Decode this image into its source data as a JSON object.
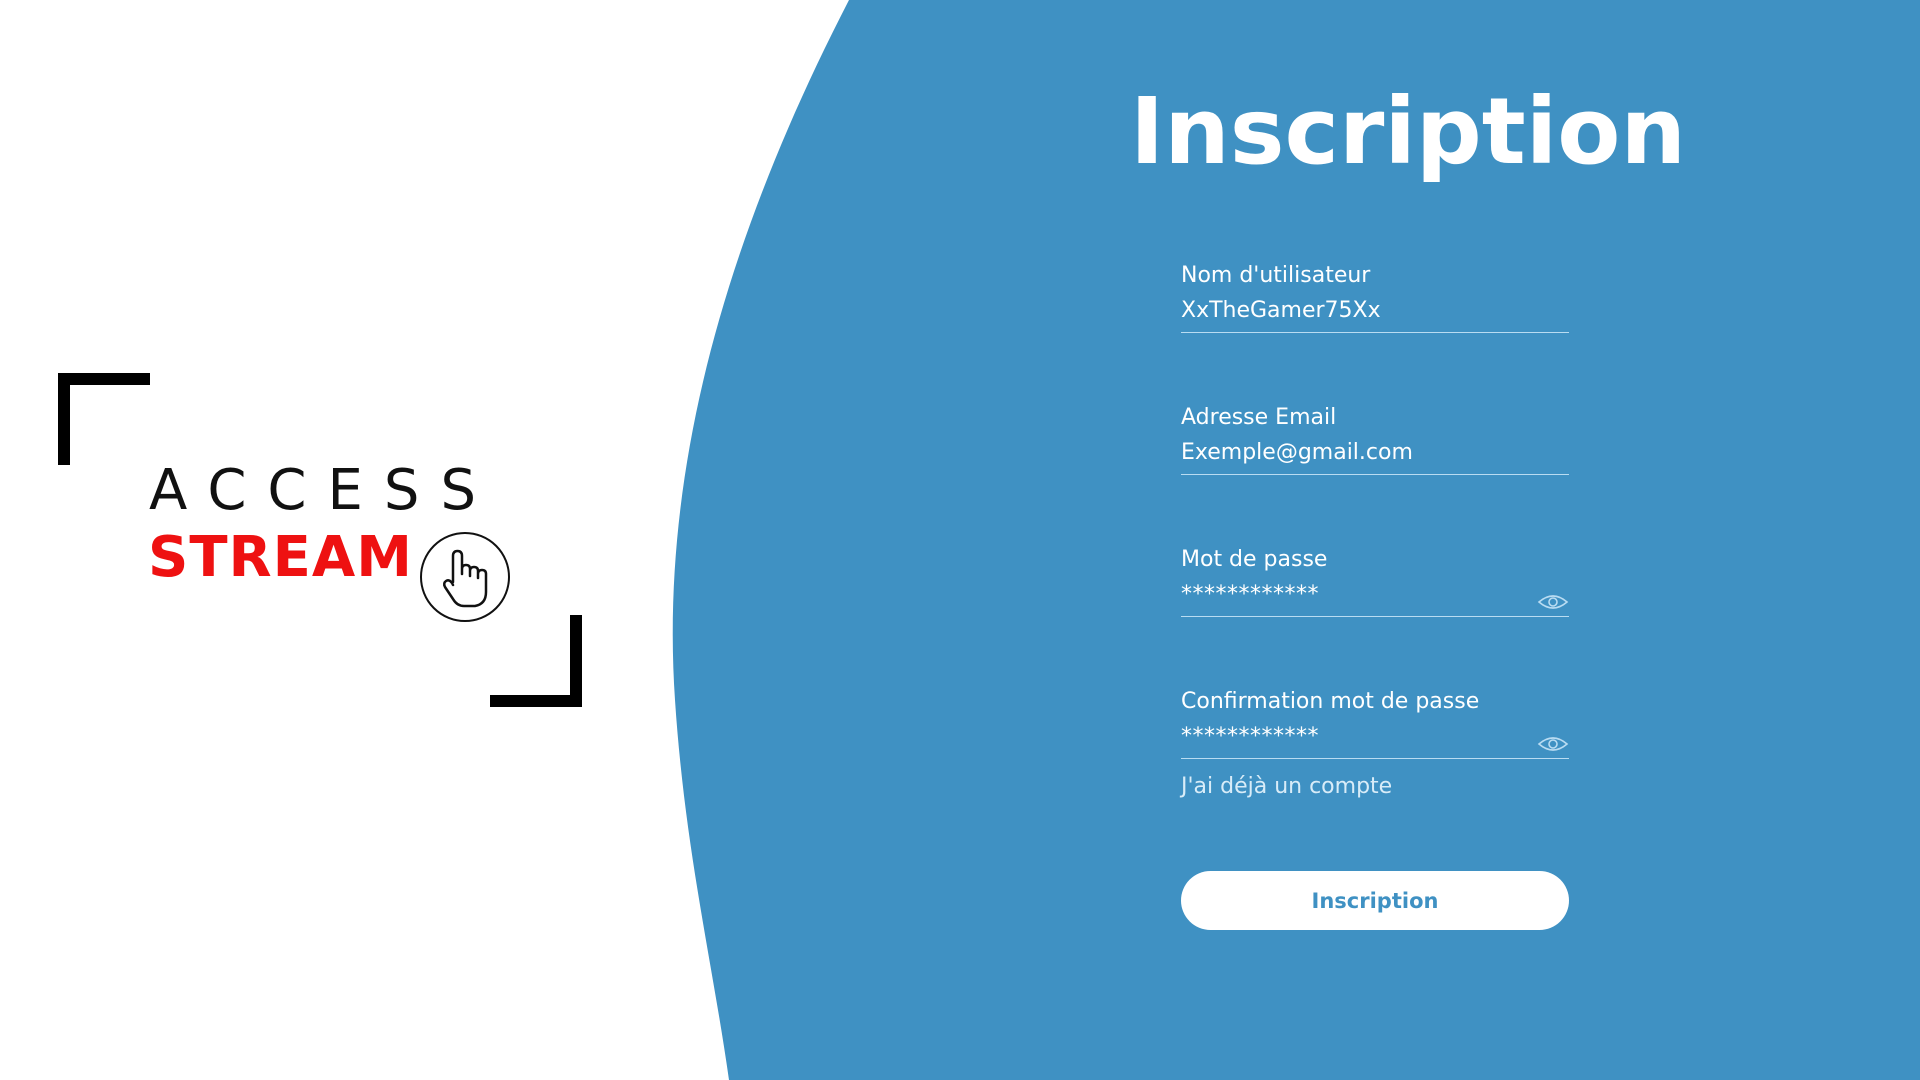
{
  "logo": {
    "word_1": "ACCESS",
    "word_2": "STREAM",
    "icon": "hand-pointer-icon",
    "word_2_color": "#ee1111"
  },
  "colors": {
    "panel": "#3f91c3",
    "background": "#ffffff",
    "button_bg": "#ffffff",
    "button_text": "#3f91c3"
  },
  "form": {
    "title": "Inscription",
    "username": {
      "label": "Nom d'utilisateur",
      "value": "XxTheGamer75Xx"
    },
    "email": {
      "label": "Adresse Email",
      "value": "Exemple@gmail.com"
    },
    "password": {
      "label": "Mot de passe",
      "value": "************",
      "icon": "eye-icon"
    },
    "confirm_password": {
      "label": "Confirmation mot de passe",
      "value": "************",
      "icon": "eye-icon"
    },
    "login_link": "J'ai déjà un compte",
    "submit": "Inscription"
  }
}
